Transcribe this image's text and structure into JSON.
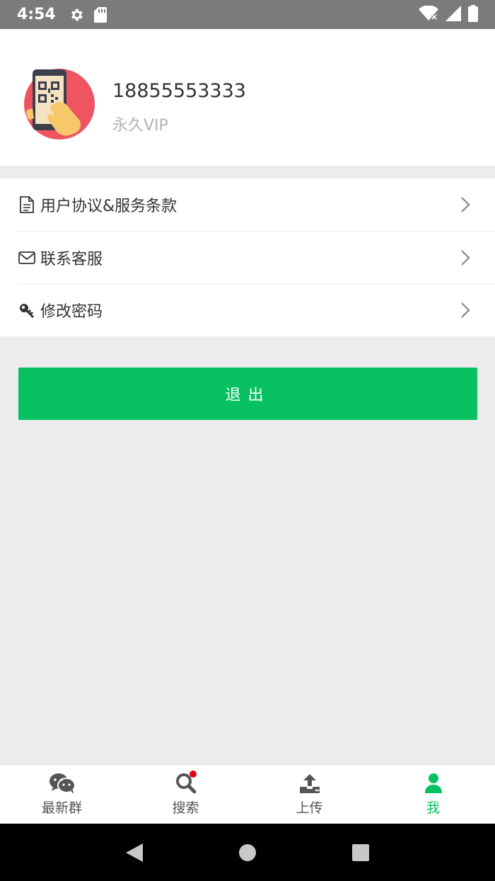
{
  "status_bar": {
    "time": "4:54",
    "icons": [
      "settings-icon",
      "sd-card-icon",
      "wifi-icon",
      "signal-icon",
      "battery-icon"
    ]
  },
  "profile": {
    "phone": "18855553333",
    "membership": "永久VIP",
    "avatar": "qr-scan-avatar"
  },
  "menu": {
    "items": [
      {
        "label": "用户协议&服务条款",
        "icon": "document-icon"
      },
      {
        "label": "联系客服",
        "icon": "mail-icon"
      },
      {
        "label": "修改密码",
        "icon": "key-icon"
      }
    ]
  },
  "logout_button": {
    "label": "退出"
  },
  "tabbar": {
    "tabs": [
      {
        "label": "最新群",
        "icon": "wechat-icon",
        "active": false
      },
      {
        "label": "搜索",
        "icon": "search-icon",
        "active": false,
        "badge": true
      },
      {
        "label": "上传",
        "icon": "upload-icon",
        "active": false
      },
      {
        "label": "我",
        "icon": "user-icon",
        "active": true
      }
    ]
  },
  "colors": {
    "accent": "#07c160",
    "status_bar": "#7b7b7b",
    "background": "#ececec",
    "badge": "#e60012"
  }
}
